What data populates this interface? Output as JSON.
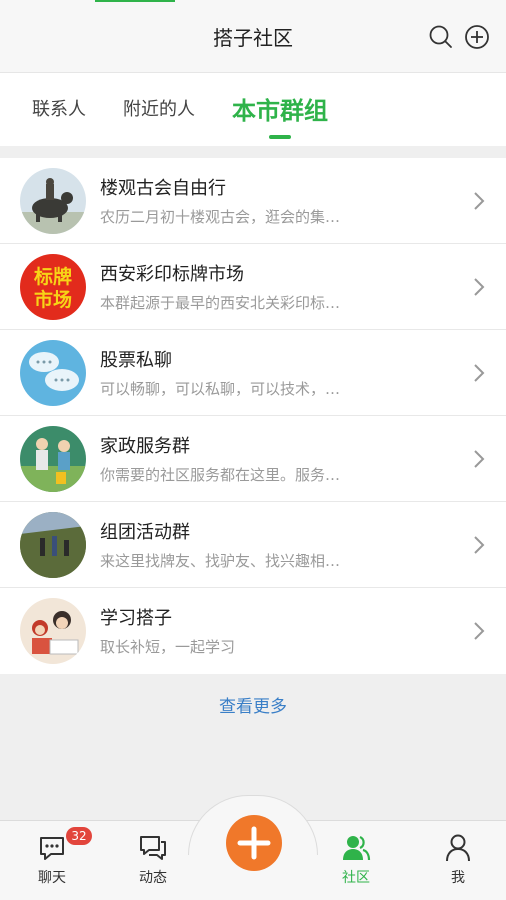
{
  "header": {
    "title": "搭子社区",
    "icons": [
      "search-icon",
      "add-circle-icon"
    ]
  },
  "tabs": [
    {
      "label": "联系人",
      "active": false
    },
    {
      "label": "附近的人",
      "active": false
    },
    {
      "label": "本市群组",
      "active": true
    }
  ],
  "groups": [
    {
      "name": "楼观古会自由行",
      "desc": "农历二月初十楼观古会，逛会的集…",
      "avatar": "ox-statue-photo"
    },
    {
      "name": "西安彩印标牌市场",
      "desc": "本群起源于最早的西安北关彩印标…",
      "avatar": "sign-text-avatar",
      "avatar_text": [
        "标牌",
        "市场"
      ]
    },
    {
      "name": "股票私聊",
      "desc": "可以畅聊，可以私聊，可以技术，…",
      "avatar": "chat-bubbles-avatar"
    },
    {
      "name": "家政服务群",
      "desc": "你需要的社区服务都在这里。服务…",
      "avatar": "workers-cartoon-avatar"
    },
    {
      "name": "组团活动群",
      "desc": "来这里找牌友、找驴友、找兴趣相…",
      "avatar": "hikers-photo"
    },
    {
      "name": "学习搭子",
      "desc": "取长补短，一起学习",
      "avatar": "study-cartoon-avatar"
    }
  ],
  "more_label": "查看更多",
  "bottom_nav": [
    {
      "label": "聊天",
      "icon": "chat-icon",
      "badge": "32",
      "active": false
    },
    {
      "label": "动态",
      "icon": "moments-icon",
      "active": false
    },
    {
      "label": "社区",
      "icon": "community-icon",
      "active": true
    },
    {
      "label": "我",
      "icon": "profile-icon",
      "active": false
    }
  ],
  "colors": {
    "accent": "#2fb34a",
    "fab": "#f0782a",
    "badge": "#e2453c",
    "link": "#3a7fc7"
  }
}
